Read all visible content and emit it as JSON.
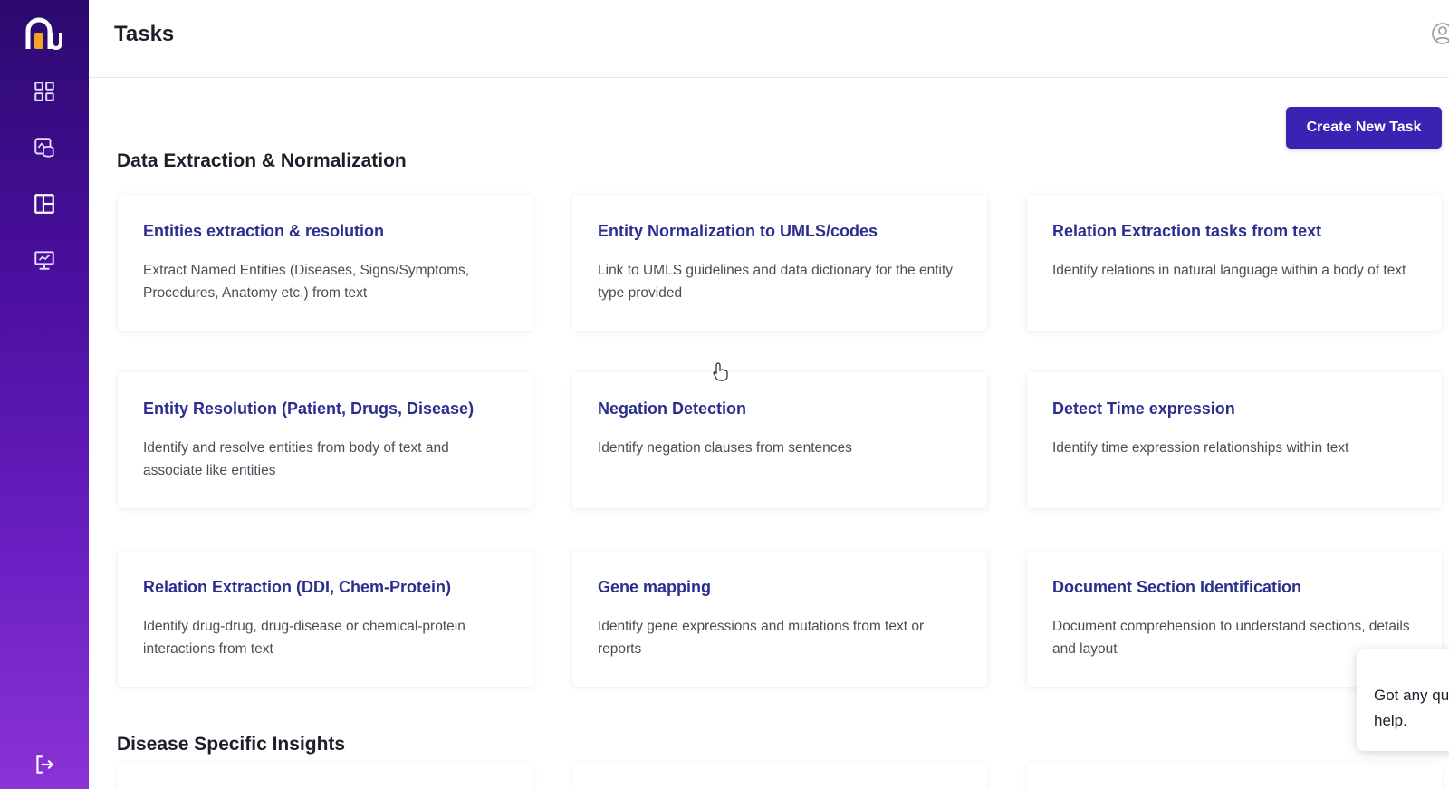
{
  "app": {
    "title": "Tasks"
  },
  "sidebar": {
    "items": [
      {
        "icon": "grid-icon"
      },
      {
        "icon": "database-icon"
      },
      {
        "icon": "layout-icon"
      },
      {
        "icon": "monitor-icon"
      }
    ],
    "footer_icon": "logout-icon"
  },
  "header": {
    "title": "Tasks",
    "user_icon": "user-circle-icon"
  },
  "toolbar": {
    "create_label": "Create New Task"
  },
  "sections": [
    {
      "title": "Data Extraction & Normalization",
      "cards": [
        {
          "title": "Entities extraction & resolution",
          "description": "Extract Named Entities (Diseases, Signs/Symptoms, Procedures, Anatomy etc.) from text"
        },
        {
          "title": "Entity Normalization to UMLS/codes",
          "description": "Link to UMLS guidelines and data dictionary for the entity type provided"
        },
        {
          "title": "Relation Extraction tasks from text",
          "description": "Identify relations in natural language within a body of text"
        },
        {
          "title": "Entity Resolution (Patient, Drugs, Disease)",
          "description": "Identify and resolve entities from body of text and associate like entities"
        },
        {
          "title": "Negation Detection",
          "description": "Identify negation clauses from sentences"
        },
        {
          "title": "Detect Time expression",
          "description": "Identify time expression relationships within text"
        },
        {
          "title": "Relation Extraction (DDI, Chem-Protein)",
          "description": "Identify drug-drug, drug-disease or chemical-protein interactions from text"
        },
        {
          "title": "Gene mapping",
          "description": "Identify gene expressions and mutations from text or reports"
        },
        {
          "title": "Document Section Identification",
          "description": "Document comprehension to understand sections, details and layout"
        }
      ]
    },
    {
      "title": "Disease Specific Insights"
    }
  ],
  "chat": {
    "line1": "Got any qu",
    "line2": "help."
  },
  "colors": {
    "accent": "#3a23b3",
    "card_title": "#2a2f8f",
    "sidebar_top": "#2b0a6e",
    "sidebar_bottom": "#8a33d6"
  }
}
